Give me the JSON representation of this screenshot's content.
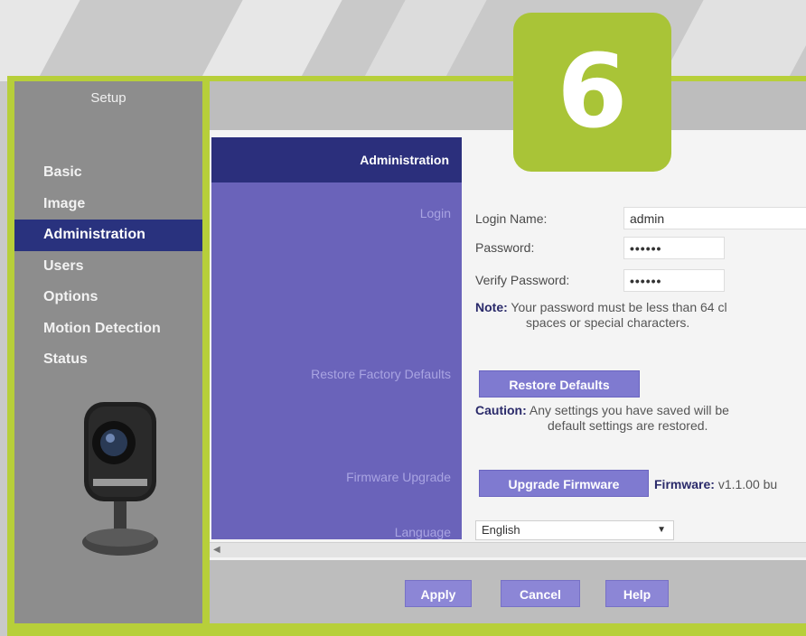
{
  "step_number": "6",
  "sidebar": {
    "title": "Setup",
    "items": [
      {
        "label": "Basic",
        "active": false
      },
      {
        "label": "Image",
        "active": false
      },
      {
        "label": "Administration",
        "active": true
      },
      {
        "label": "Users",
        "active": false
      },
      {
        "label": "Options",
        "active": false
      },
      {
        "label": "Motion Detection",
        "active": false
      },
      {
        "label": "Status",
        "active": false
      }
    ]
  },
  "section": {
    "header": "Administration",
    "labels": {
      "login": "Login",
      "restore": "Restore Factory Defaults",
      "firmware": "Firmware Upgrade",
      "language": "Language"
    }
  },
  "login": {
    "name_label": "Login Name:",
    "name_value": "admin",
    "password_label": "Password:",
    "password_value": "••••••",
    "verify_label": "Verify Password:",
    "verify_value": "••••••",
    "note_prefix": "Note:",
    "note_line1": "Your password must be less than 64 cl",
    "note_line2": "spaces or special characters."
  },
  "restore": {
    "button": "Restore Defaults",
    "caution_prefix": "Caution:",
    "caution_line1": "Any settings you have saved will be",
    "caution_line2": "default settings are restored."
  },
  "firmware": {
    "button": "Upgrade Firmware",
    "label_prefix": "Firmware:",
    "version": "v1.1.00 bu"
  },
  "language": {
    "selected": "English"
  },
  "footer": {
    "apply": "Apply",
    "cancel": "Cancel",
    "help": "Help"
  },
  "colors": {
    "frame": "#b7cf3a",
    "badge": "#a9c437",
    "sidebar": "#8d8d8d",
    "nav_active": "#29327e",
    "section_bg": "#6a63ba",
    "button": "#7f7ad0"
  }
}
